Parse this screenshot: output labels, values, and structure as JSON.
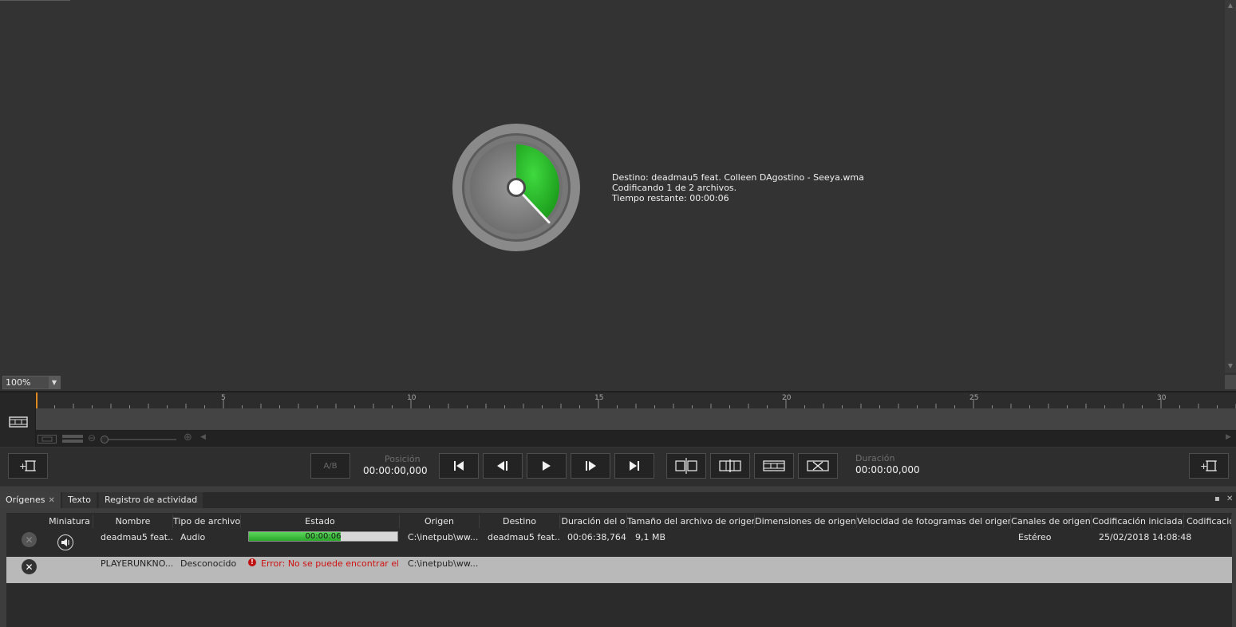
{
  "encoding": {
    "destination_line": "Destino: deadmau5 feat. Colleen DAgostino - Seeya.wma",
    "count_line": "Codificando 1 de 2 archivos.",
    "remaining_line": "Tiempo restante: 00:00:06",
    "progress": 0.38,
    "dial_color": "#2db82d"
  },
  "zoom": {
    "value": "100%"
  },
  "timeline": {
    "ruler_labels": [
      "5",
      "10",
      "15",
      "20",
      "25",
      "30"
    ],
    "playhead_color": "#e08a20"
  },
  "transport": {
    "ab_label": "A/B",
    "position_label": "Posición",
    "position_value": "00:00:00,000",
    "duration_label": "Duración",
    "duration_value": "00:00:00,000"
  },
  "panel": {
    "tabs": [
      {
        "label": "Orígenes",
        "active": true
      },
      {
        "label": "Texto",
        "active": false
      },
      {
        "label": "Registro de actividad",
        "active": false
      }
    ]
  },
  "table": {
    "columns": [
      "Miniatura",
      "Nombre",
      "Tipo de archivo",
      "Estado",
      "Origen",
      "Destino",
      "Duración del o",
      "Tamaño del archivo de origen",
      "Dimensiones de origen",
      "Velocidad de fotogramas del origen",
      "Canales de origen",
      "Codificación iniciada",
      "Codificació"
    ],
    "rows": [
      {
        "name": "deadmau5 feat...",
        "type": "Audio",
        "status_time": "00:00:06",
        "status_progress": 0.62,
        "origin": "C:\\inetpub\\ww...",
        "destination": "deadmau5 feat...",
        "duration": "00:06:38,764",
        "size": "9,1 MB",
        "channels": "Estéreo",
        "started": "25/02/2018 14:08:48"
      },
      {
        "name": "PLAYERUNKNO...",
        "type": "Desconocido",
        "status_error": "Error: No se puede encontrar el códec",
        "origin": "C:\\inetpub\\ww..."
      }
    ]
  }
}
